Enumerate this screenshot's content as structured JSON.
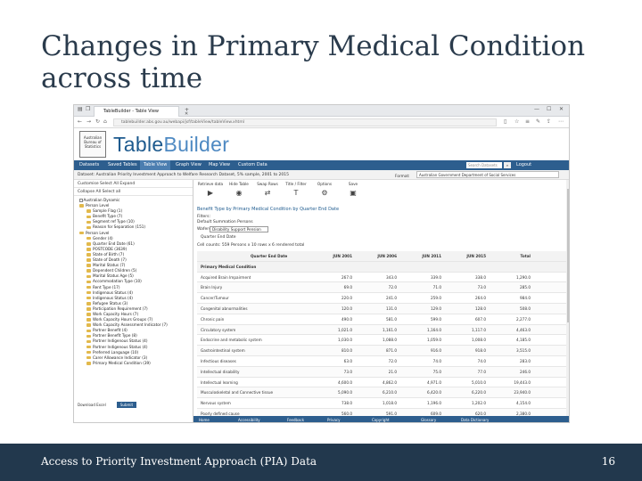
{
  "slide": {
    "title_line1": "Changes in Primary Medical Condition",
    "title_line2": "across time",
    "footer_text": "Access to Priority Investment Approach (PIA) Data",
    "page_number": "16"
  },
  "browser": {
    "tab_title": "TableBuilder - Table View",
    "url": "tablebuilder.abs.gov.au/webapi/jsf/tableView/tableView.xhtml"
  },
  "app": {
    "logo_text": "Australian Bureau of Statistics",
    "brand_prefix": "Table",
    "brand_suffix": "Builder",
    "menu": [
      "Datasets",
      "Saved Tables",
      "Table View",
      "Graph View",
      "Map View",
      "Custom Data"
    ],
    "search_placeholder": "Search Datasets",
    "logout_label": "Logout",
    "dataset_label": "Dataset: Australian Priority Investment Approach to Welfare Research Dataset, 5% sample, 2001 to 2015",
    "format_label": "Format:",
    "format_value": "Australian Government Department of Social Services"
  },
  "left_panel": {
    "row1": "Customise  Select All  Expand",
    "row2": "Collapse All   Select all",
    "tree": [
      "Australian Dynamic",
      "Person Level",
      "Sample Flag (1)",
      "Benefit Type (7)",
      "Segment ref Type (10)",
      "Reason for Separation (151)",
      "Person Level",
      "Gender (4)",
      "Quarter End Date (61)",
      "POSTCODE (3639)",
      "State of Birth (7)",
      "State of Death (7)",
      "Marital Status (7)",
      "Dependent Children (5)",
      "Marital Status Age (5)",
      "Accommodation Type (10)",
      "Rent Type (17)",
      "Indigenous Status (4)",
      "Indigenous Status (4)",
      "Refugee Status (3)",
      "Participation Requirement (7)",
      "Work Capacity Hours (7)",
      "Work Capacity Hours Groups (7)",
      "Work Capacity Assessment Indicator (7)",
      "Partner Benefit (4)",
      "Partner Benefit Type (8)",
      "Partner Indigenous Status (4)",
      "Partner Indigenous Status (4)",
      "Preferred Language (10)",
      "Carer Allowance Indicator (3)",
      "Primary Medical Condition (39)"
    ],
    "bottom_label": "Download  Excel",
    "button_label": "Submit"
  },
  "main": {
    "toolbar": [
      "Retrieve data",
      "Hide Table",
      "Swap Rows",
      "Title / Filter",
      "Options",
      "Save"
    ],
    "table_title": "Benefit Type by Primary Medical Condition by Quarter End Date",
    "filters_label": "Filters:",
    "filter_text": "Default Summation  Persons",
    "wafer_label": "Wafers:",
    "wafer_value": "Disability Support Pension",
    "wafer_sub": "Quarter End Date",
    "cells_label": "Cell counts: 559 Persons x 10 rows x 6 rendered total",
    "col_header_label": "Quarter End Date",
    "columns": [
      "JUN 2001",
      "JUN 2006",
      "JUN 2011",
      "JUN 2015",
      "Total"
    ],
    "row_header": "Primary Medical Condition",
    "rows": [
      {
        "label": "Acquired Brain Impairment",
        "values": [
          "267.0",
          "343.0",
          "339.0",
          "338.0",
          "1,290.0"
        ]
      },
      {
        "label": "Brain Injury",
        "values": [
          "69.0",
          "72.0",
          "71.0",
          "73.0",
          "285.0"
        ]
      },
      {
        "label": "Cancer/Tumour",
        "values": [
          "220.0",
          "241.0",
          "259.0",
          "264.0",
          "984.0"
        ]
      },
      {
        "label": "Congenital abnormalities",
        "values": [
          "120.0",
          "131.0",
          "129.0",
          "128.0",
          "508.0"
        ]
      },
      {
        "label": "Chronic pain",
        "values": [
          "490.0",
          "581.0",
          "599.0",
          "607.0",
          "2,277.0"
        ]
      },
      {
        "label": "Circulatory system",
        "values": [
          "1,021.0",
          "1,161.0",
          "1,164.0",
          "1,117.0",
          "4,463.0"
        ]
      },
      {
        "label": "Endocrine and metabolic system",
        "values": [
          "1,030.0",
          "1,088.0",
          "1,059.0",
          "1,008.0",
          "4,185.0"
        ]
      },
      {
        "label": "Gastrointestinal system",
        "values": [
          "810.0",
          "871.0",
          "916.0",
          "918.0",
          "3,515.0"
        ]
      },
      {
        "label": "Infectious diseases",
        "values": [
          "63.0",
          "72.0",
          "74.0",
          "74.0",
          "283.0"
        ]
      },
      {
        "label": "Intellectual disability",
        "values": [
          "73.0",
          "21.0",
          "75.0",
          "77.0",
          "246.0"
        ]
      },
      {
        "label": "Intellectual learning",
        "values": [
          "4,600.0",
          "4,862.0",
          "4,971.0",
          "5,010.0",
          "19,443.0"
        ]
      },
      {
        "label": "Musculoskeletal and Connective tissue",
        "values": [
          "5,090.0",
          "6,210.0",
          "6,420.0",
          "6,220.0",
          "23,940.0"
        ]
      },
      {
        "label": "Nervous system",
        "values": [
          "738.0",
          "1,018.0",
          "1,196.0",
          "1,202.0",
          "4,154.0"
        ]
      },
      {
        "label": "Poorly defined cause",
        "values": [
          "560.0",
          "591.0",
          "609.0",
          "620.0",
          "2,380.0"
        ]
      },
      {
        "label": "Psychological/psychiatric",
        "values": [
          "4,200.0",
          "6,300.0",
          "7,011.0",
          "7,700.0",
          "25,211.0"
        ]
      },
      {
        "label": "Respiratory system",
        "values": [
          "710.0",
          "795.0",
          "806.0",
          "823.0",
          "3,134.0"
        ]
      }
    ]
  },
  "statusbar": [
    "Home",
    "Accessibility",
    "Feedback",
    "Privacy",
    "Copyright",
    "Glossary",
    "Data Dictionary"
  ]
}
